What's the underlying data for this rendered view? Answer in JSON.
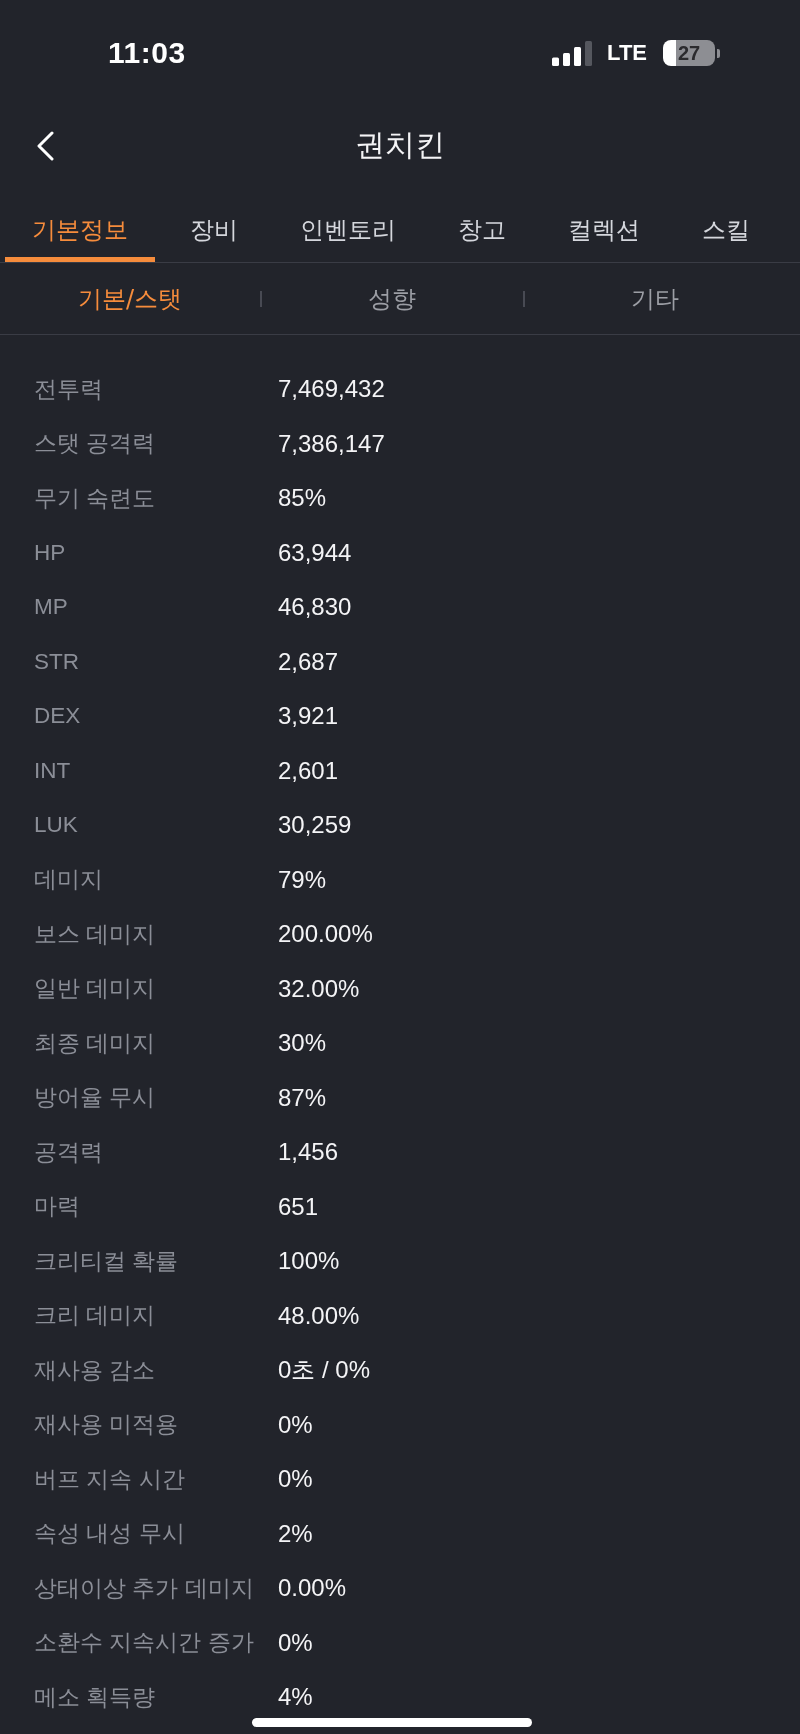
{
  "status_bar": {
    "time": "11:03",
    "network": "LTE",
    "battery": "27"
  },
  "header": {
    "title": "권치킨"
  },
  "tabs": [
    {
      "label": "기본정보",
      "selected": true
    },
    {
      "label": "장비",
      "selected": false
    },
    {
      "label": "인벤토리",
      "selected": false
    },
    {
      "label": "창고",
      "selected": false
    },
    {
      "label": "컬렉션",
      "selected": false
    },
    {
      "label": "스킬",
      "selected": false
    }
  ],
  "sub_tabs": [
    {
      "label": "기본/스탯",
      "selected": true
    },
    {
      "label": "성향",
      "selected": false
    },
    {
      "label": "기타",
      "selected": false
    }
  ],
  "stats": [
    {
      "label": "전투력",
      "value": "7,469,432"
    },
    {
      "label": "스탯 공격력",
      "value": "7,386,147"
    },
    {
      "label": "무기 숙련도",
      "value": "85%"
    },
    {
      "label": "HP",
      "value": "63,944"
    },
    {
      "label": "MP",
      "value": "46,830"
    },
    {
      "label": "STR",
      "value": "2,687"
    },
    {
      "label": "DEX",
      "value": "3,921"
    },
    {
      "label": "INT",
      "value": "2,601"
    },
    {
      "label": "LUK",
      "value": "30,259"
    },
    {
      "label": "데미지",
      "value": "79%"
    },
    {
      "label": "보스 데미지",
      "value": "200.00%"
    },
    {
      "label": "일반 데미지",
      "value": "32.00%"
    },
    {
      "label": "최종 데미지",
      "value": "30%"
    },
    {
      "label": "방어율 무시",
      "value": "87%"
    },
    {
      "label": "공격력",
      "value": "1,456"
    },
    {
      "label": "마력",
      "value": "651"
    },
    {
      "label": "크리티컬 확률",
      "value": "100%"
    },
    {
      "label": "크리 데미지",
      "value": "48.00%"
    },
    {
      "label": "재사용 감소",
      "value": "0초 / 0%"
    },
    {
      "label": "재사용 미적용",
      "value": "0%"
    },
    {
      "label": "버프 지속 시간",
      "value": "0%"
    },
    {
      "label": "속성 내성 무시",
      "value": "2%"
    },
    {
      "label": "상태이상 추가 데미지",
      "value": "0.00%"
    },
    {
      "label": "소환수 지속시간 증가",
      "value": "0%"
    },
    {
      "label": "메소 획득량",
      "value": "4%"
    }
  ]
}
